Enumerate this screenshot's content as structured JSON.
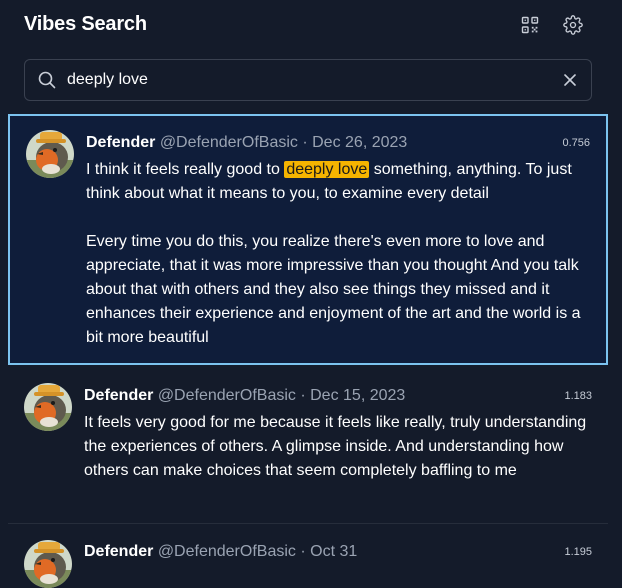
{
  "header": {
    "title": "Vibes Search",
    "qr_icon": "qr-code-icon",
    "settings_icon": "gear-icon"
  },
  "search": {
    "value": "deeply love",
    "placeholder": ""
  },
  "results": [
    {
      "author": "Defender",
      "handle": "@DefenderOfBasic",
      "separator": "·",
      "date": "Dec 26, 2023",
      "score": "0.756",
      "paragraph1_before": "I think it feels really good to ",
      "paragraph1_highlight": "deeply love",
      "paragraph1_after": " something, anything. To just think about what it means to you, to examine every detail",
      "paragraph2": "Every time you do this, you realize there's even more to love and appreciate, that it was more impressive than you thought And you talk about that with others and they also see things they missed and it enhances their experience and enjoyment of the art and the world is a bit more beautiful"
    },
    {
      "author": "Defender",
      "handle": "@DefenderOfBasic",
      "separator": "·",
      "date": "Dec 15, 2023",
      "score": "1.183",
      "text": "It feels very good for me because it feels like really, truly understanding the experiences of others. A glimpse inside. And understanding how others can make choices that seem completely baffling to me"
    },
    {
      "author": "Defender",
      "handle": "@DefenderOfBasic",
      "separator": "·",
      "date": "Oct 31",
      "score": "1.195"
    }
  ],
  "colors": {
    "background": "#141b2a",
    "selected_background": "#0f1d3a",
    "selected_border": "#7cc3ef",
    "highlight": "#f5b400",
    "muted_text": "#9aa3b2"
  }
}
